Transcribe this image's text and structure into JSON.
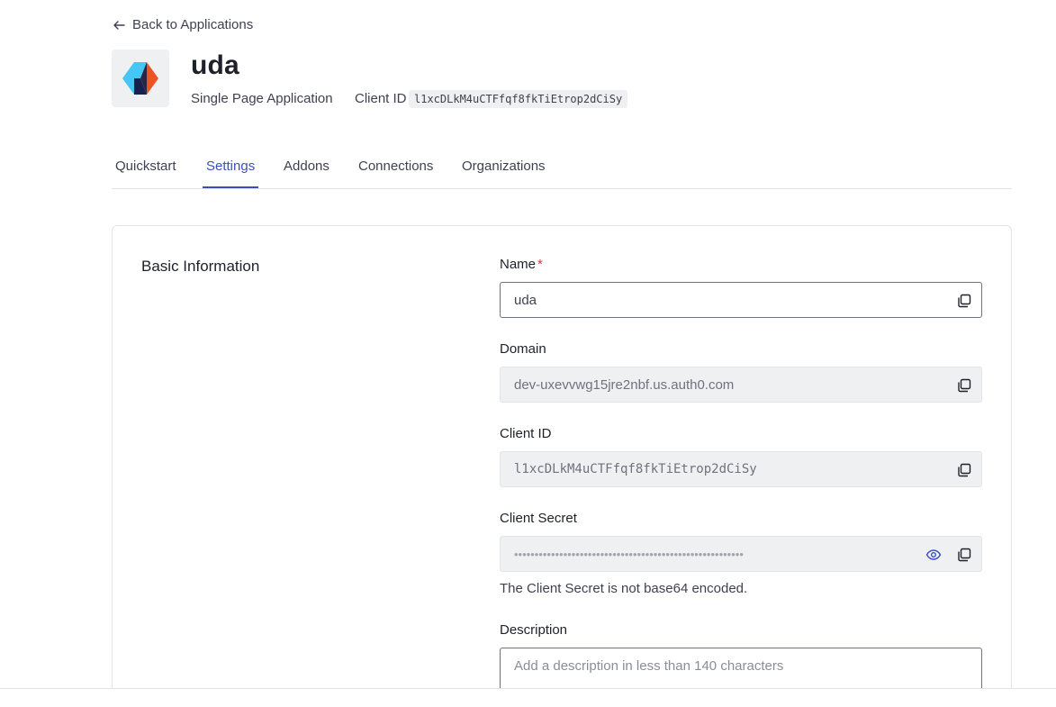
{
  "nav": {
    "back_label": "Back to Applications"
  },
  "app": {
    "name": "uda",
    "type": "Single Page Application",
    "client_id_label": "Client ID",
    "client_id": "l1xcDLkM4uCTFfqf8fkTiEtrop2dCiSy",
    "logo_icon": "auth0-app-logo"
  },
  "tabs": [
    {
      "label": "Quickstart",
      "active": false
    },
    {
      "label": "Settings",
      "active": true
    },
    {
      "label": "Addons",
      "active": false
    },
    {
      "label": "Connections",
      "active": false
    },
    {
      "label": "Organizations",
      "active": false
    }
  ],
  "basic_info": {
    "title": "Basic Information",
    "name_label": "Name",
    "name_required_mark": "*",
    "name_value": "uda",
    "domain_label": "Domain",
    "domain_value": "dev-uxevvwg15jre2nbf.us.auth0.com",
    "client_id_label": "Client ID",
    "client_id_value": "l1xcDLkM4uCTFfqf8fkTiEtrop2dCiSy",
    "client_secret_label": "Client Secret",
    "client_secret_masked": "••••••••••••••••••••••••••••••••••••••••••••••••••••••••",
    "client_secret_hint": "The Client Secret is not base64 encoded.",
    "description_label": "Description",
    "description_placeholder": "Add a description in less than 140 characters"
  },
  "colors": {
    "accent": "#3b4ec4",
    "required": "#d03c38",
    "readonly_bg": "#eff0f2",
    "logo_blue": "#44c7f4",
    "logo_orange": "#eb5424",
    "logo_navy": "#16214d"
  }
}
